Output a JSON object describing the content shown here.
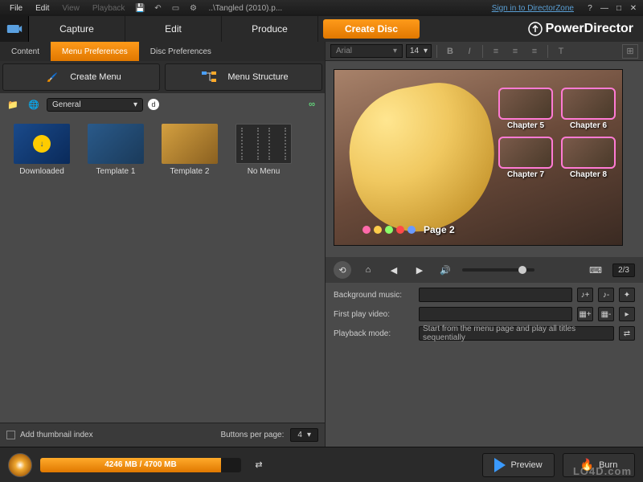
{
  "titlebar": {
    "menus": {
      "file": "File",
      "edit": "Edit",
      "view": "View",
      "playback": "Playback"
    },
    "document": "..\\Tangled (2010).p...",
    "signin": "Sign in to DirectorZone",
    "help_icon": "?"
  },
  "brand": "PowerDirector",
  "main_tabs": {
    "capture": "Capture",
    "edit": "Edit",
    "produce": "Produce",
    "create_disc": "Create Disc"
  },
  "subtabs": {
    "content": "Content",
    "menu_prefs": "Menu Preferences",
    "disc_prefs": "Disc Preferences"
  },
  "menu_buttons": {
    "create_menu": "Create Menu",
    "menu_structure": "Menu Structure"
  },
  "category": "General",
  "templates": [
    {
      "label": "Downloaded"
    },
    {
      "label": "Template 1"
    },
    {
      "label": "Template 2"
    },
    {
      "label": "No Menu"
    }
  ],
  "left_footer": {
    "add_thumb": "Add thumbnail index",
    "buttons_per_page_label": "Buttons per page:",
    "buttons_per_page_value": "4"
  },
  "text_toolbar": {
    "font": "Arial",
    "size": "14"
  },
  "preview": {
    "chapters": [
      "Chapter 5",
      "Chapter 6",
      "Chapter 7",
      "Chapter 8"
    ],
    "page_label": "Page 2"
  },
  "play_controls": {
    "page_counter": "2/3"
  },
  "settings": {
    "bg_music_label": "Background music:",
    "first_play_label": "First play video:",
    "playback_mode_label": "Playback mode:",
    "playback_mode_value": "Start from the menu page and play all titles sequentially"
  },
  "bottom": {
    "disc_usage": "4246 MB / 4700 MB",
    "preview_btn": "Preview",
    "burn_btn": "Burn"
  },
  "watermark": "LO4D.com"
}
